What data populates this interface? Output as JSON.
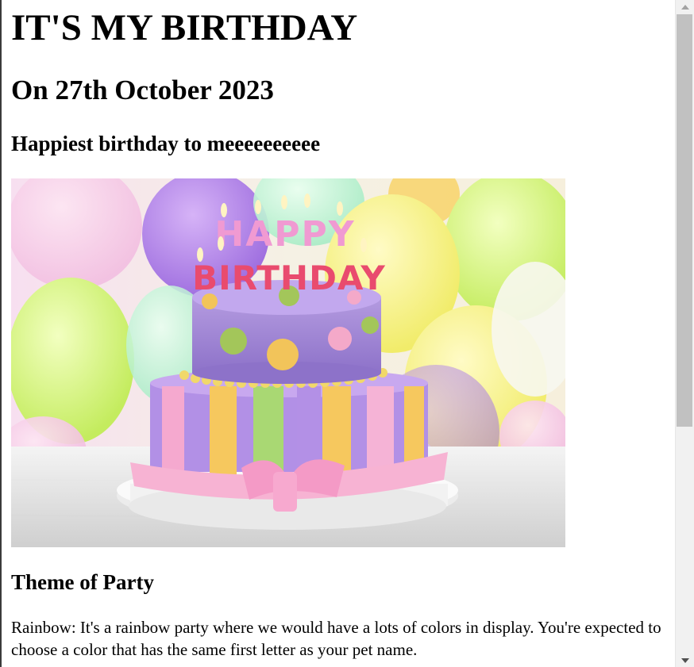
{
  "page": {
    "title": "IT'S MY BIRTHDAY",
    "date_heading": "On 27th October 2023",
    "greeting": "Happiest birthday to meeeeeeeeee"
  },
  "cake_image": {
    "candle_letters_top": "HAPPY",
    "candle_letters_bottom": "BIRTHDAY"
  },
  "theme": {
    "heading": "Theme of Party",
    "description": "Rainbow: It's a rainbow party where we would have a lots of colors in display. You're expected to choose a color that has the same first letter as your pet name."
  },
  "scrollbar": {
    "up_icon": "triangle-up-icon",
    "down_icon": "triangle-down-icon"
  },
  "colors": {
    "background": "#ffffff",
    "text": "#000000",
    "scrollbar_track": "#f1f1f1",
    "scrollbar_thumb": "#c1c1c1"
  }
}
